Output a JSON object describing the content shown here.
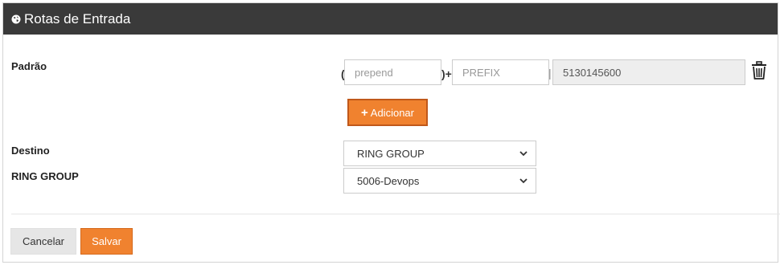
{
  "header": {
    "title": "Rotas de Entrada",
    "icon": "globe-icon",
    "background": "#3a3a3a"
  },
  "form": {
    "pattern_label": "Padrão",
    "open_paren": "(",
    "close_paren_plus": ")+",
    "separator": "|",
    "prepend": {
      "value": "",
      "placeholder": "prepend"
    },
    "prefix": {
      "value": "",
      "placeholder": "PREFIX"
    },
    "number": {
      "value": "5130145600"
    },
    "delete_icon": "trash-icon",
    "add_button_label": "Adicionar",
    "destination_label": "Destino",
    "destination_value": "RING GROUP",
    "ring_group_label": "RING GROUP",
    "ring_group_value": "5006-Devops"
  },
  "actions": {
    "cancel_label": "Cancelar",
    "save_label": "Salvar"
  },
  "colors": {
    "accent": "#f0822f",
    "header": "#3a3a3a"
  }
}
